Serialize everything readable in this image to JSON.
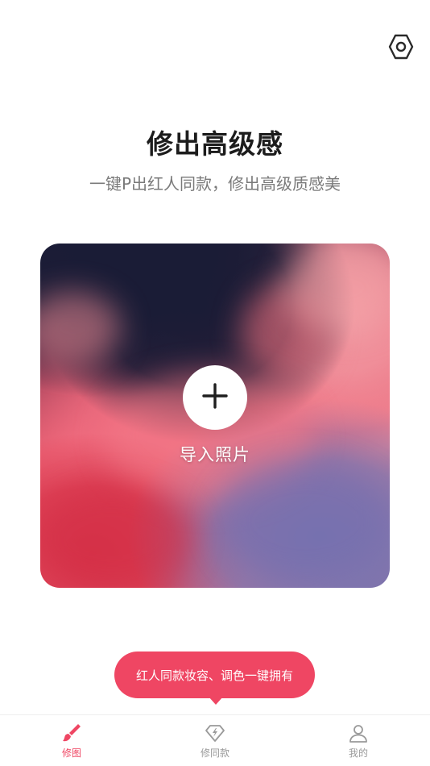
{
  "header": {
    "settings_icon": "hexagon-settings-icon",
    "title": "修出高级感",
    "subtitle": "一键P出红人同款，修出高级质感美"
  },
  "card": {
    "add_icon": "plus-icon",
    "import_label": "导入照片"
  },
  "tooltip": {
    "text": "红人同款妆容、调色一键拥有"
  },
  "tabbar": {
    "items": [
      {
        "label": "修图",
        "icon": "brush-icon",
        "active": true
      },
      {
        "label": "修同款",
        "icon": "diamond-icon",
        "active": false
      },
      {
        "label": "我的",
        "icon": "user-icon",
        "active": false
      }
    ]
  },
  "colors": {
    "accent": "#ef4663",
    "title": "#1c1c1c",
    "subtitle": "#7a7a7a",
    "inactive": "#9a9a9a"
  }
}
